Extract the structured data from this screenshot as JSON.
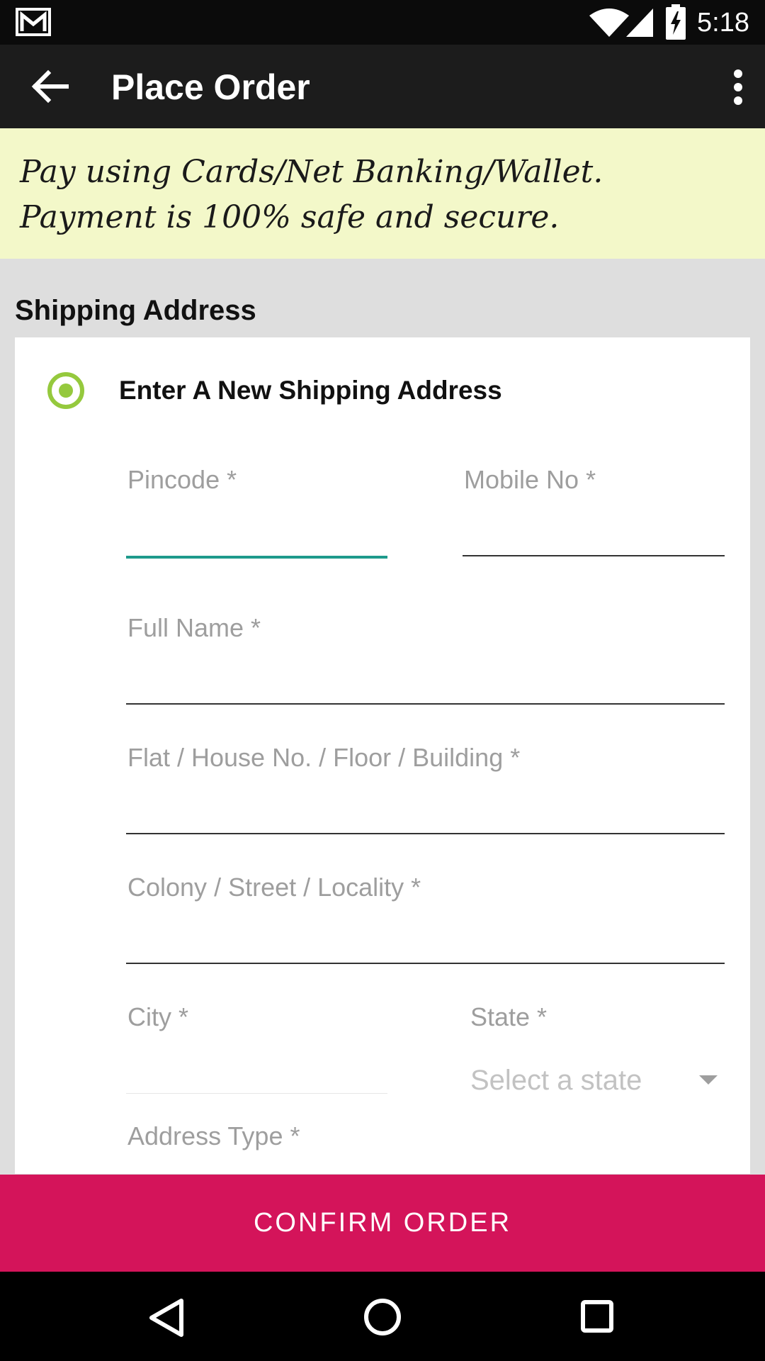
{
  "status_bar": {
    "time": "5:18",
    "icons": [
      "gmail-icon",
      "wifi-icon",
      "signal-icon",
      "battery-charging-icon"
    ]
  },
  "app_bar": {
    "title": "Place Order",
    "back_icon": "arrow-back-icon",
    "menu_icon": "more-vert-icon"
  },
  "banner": {
    "text": "Pay using Cards/Net Banking/Wallet. Payment is 100% safe and secure."
  },
  "shipping": {
    "section_title": "Shipping Address",
    "option_label": "Enter A New Shipping Address",
    "option_selected": true,
    "fields": {
      "pincode": {
        "label": "Pincode *",
        "value": ""
      },
      "mobile": {
        "label": "Mobile No *",
        "value": ""
      },
      "full_name": {
        "label": "Full Name *",
        "value": ""
      },
      "flat": {
        "label": "Flat / House No. / Floor / Building *",
        "value": ""
      },
      "colony": {
        "label": "Colony / Street / Locality *",
        "value": ""
      },
      "city": {
        "label": "City *",
        "value": ""
      },
      "state": {
        "label": "State *",
        "placeholder": "Select a state"
      },
      "address_type": {
        "label": "Address Type *"
      }
    }
  },
  "confirm_button": {
    "label": "CONFIRM ORDER"
  },
  "nav_bar": {
    "icons": [
      "nav-back-icon",
      "nav-home-icon",
      "nav-recents-icon"
    ]
  },
  "colors": {
    "accent_green": "#95c93d",
    "focus_teal": "#1e9a8c",
    "confirm_pink": "#d4145a",
    "banner_bg": "#f3f8c9"
  }
}
